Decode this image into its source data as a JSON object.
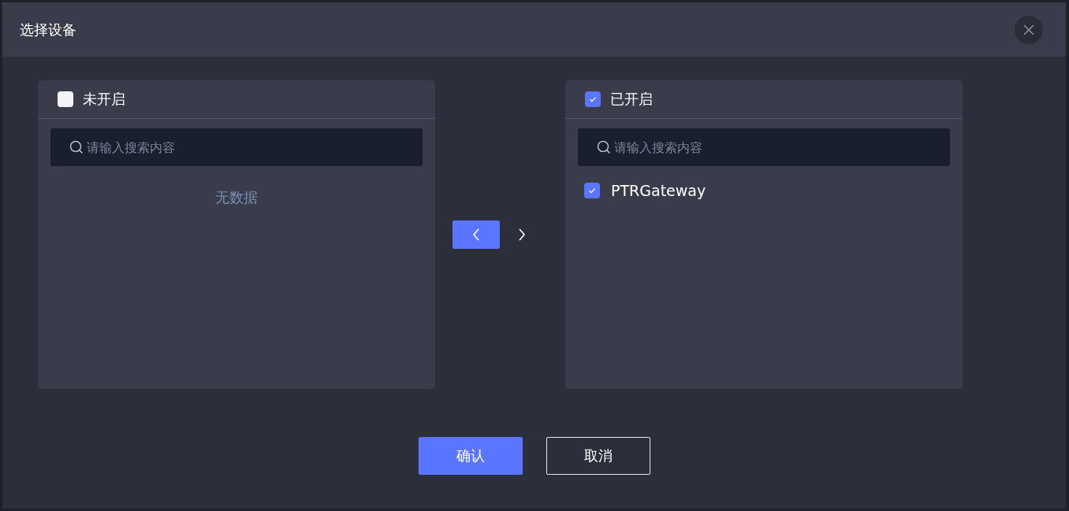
{
  "dialog": {
    "title": "选择设备"
  },
  "panels": [
    {
      "title": "未开启",
      "checked": false,
      "search": {
        "placeholder": "请输入搜索内容"
      },
      "empty_text": "无数据"
    },
    {
      "title": "已开启",
      "checked": true,
      "search": {
        "placeholder": "请输入搜索内容"
      },
      "items": [
        {
          "label": "PTRGateway",
          "checked": true
        }
      ]
    }
  ],
  "transfer_buttons": [
    {
      "kind": "left",
      "disabled": false
    },
    {
      "kind": "right",
      "disabled": true
    }
  ],
  "footer_buttons": [
    {
      "label": "确认",
      "kind": "primary"
    },
    {
      "label": "取消",
      "kind": "secondary"
    }
  ]
}
